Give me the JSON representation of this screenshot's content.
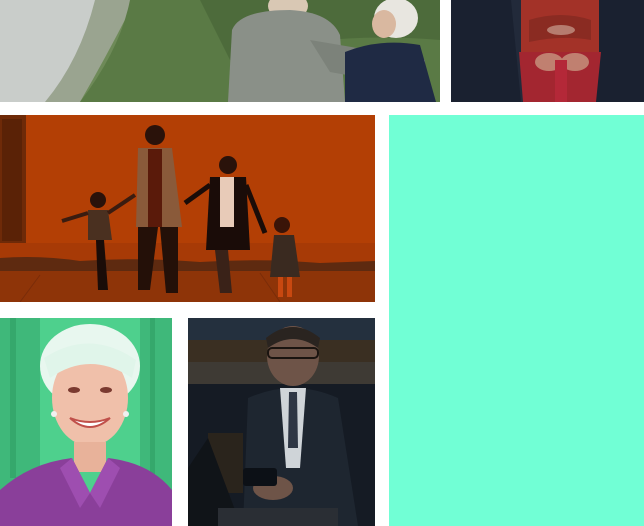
{
  "gallery": {
    "colors": {
      "background": "#ffffff",
      "mint_panel": "#71ffd5",
      "orange_overlay": "#b33f05",
      "purple_shirt": "#8a3f9a",
      "green_overlay": "#4ed08d",
      "dark_tile": "#1b2330"
    },
    "tiles": [
      {
        "name": "couple-coast-photo"
      },
      {
        "name": "graduate-gown-photo"
      },
      {
        "name": "family-walking-photo"
      },
      {
        "name": "mint-color-block"
      },
      {
        "name": "smiling-woman-photo"
      },
      {
        "name": "businessman-phone-photo"
      }
    ]
  }
}
